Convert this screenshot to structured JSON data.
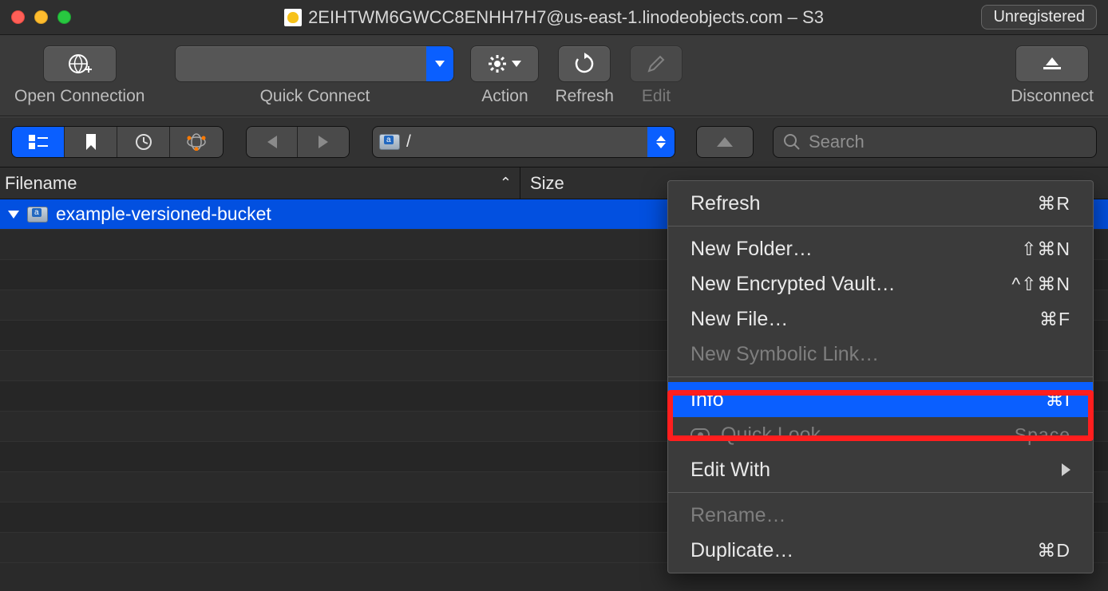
{
  "window": {
    "title": "2EIHTWM6GWCC8ENHH7H7@us-east-1.linodeobjects.com – S3",
    "badge": "Unregistered"
  },
  "toolbar": {
    "open_connection": "Open Connection",
    "quick_connect": "Quick Connect",
    "action": "Action",
    "refresh": "Refresh",
    "edit": "Edit",
    "disconnect": "Disconnect"
  },
  "subbar": {
    "path": "/",
    "search_placeholder": "Search"
  },
  "columns": {
    "filename": "Filename",
    "size": "Size"
  },
  "rows": [
    {
      "name": "example-versioned-bucket",
      "selected": true
    }
  ],
  "context_menu": {
    "refresh": {
      "label": "Refresh",
      "shortcut": "⌘R",
      "enabled": true
    },
    "new_folder": {
      "label": "New Folder…",
      "shortcut": "⇧⌘N",
      "enabled": true
    },
    "new_vault": {
      "label": "New Encrypted Vault…",
      "shortcut": "^⇧⌘N",
      "enabled": true
    },
    "new_file": {
      "label": "New File…",
      "shortcut": "⌘F",
      "enabled": true
    },
    "new_symlink": {
      "label": "New Symbolic Link…",
      "shortcut": "",
      "enabled": false
    },
    "info": {
      "label": "Info",
      "shortcut": "⌘I",
      "enabled": true,
      "highlighted": true
    },
    "quick_look": {
      "label": "Quick Look",
      "shortcut": "Space",
      "enabled": false
    },
    "edit_with": {
      "label": "Edit With",
      "shortcut": "",
      "enabled": true,
      "submenu": true
    },
    "rename": {
      "label": "Rename…",
      "shortcut": "",
      "enabled": false
    },
    "duplicate": {
      "label": "Duplicate…",
      "shortcut": "⌘D",
      "enabled": true
    }
  }
}
